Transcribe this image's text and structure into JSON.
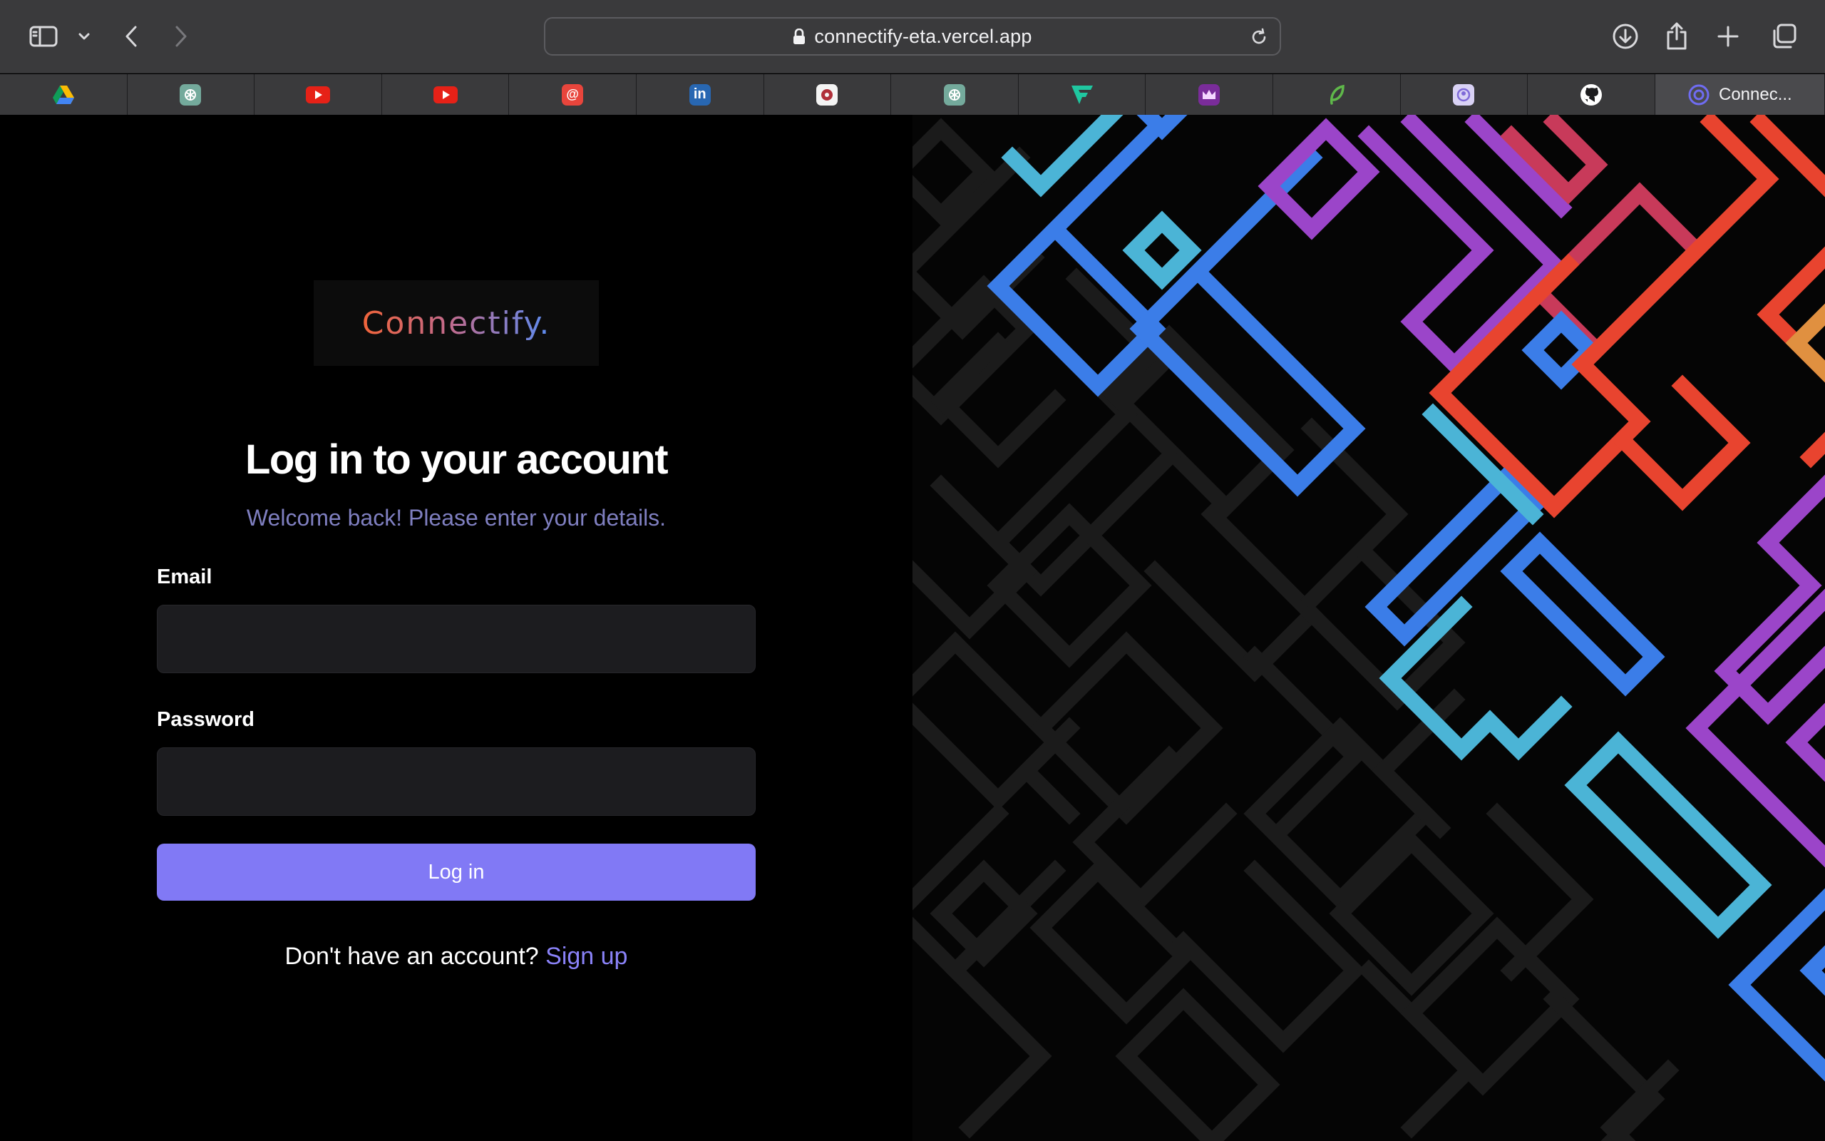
{
  "browser": {
    "url": "connectify-eta.vercel.app",
    "tabs": [
      {
        "icon": "google-drive-icon",
        "color": "#2a7de1"
      },
      {
        "icon": "chatgpt-icon",
        "color": "#74aa9c"
      },
      {
        "icon": "youtube-icon",
        "color": "#e62117"
      },
      {
        "icon": "youtube-icon",
        "color": "#e62117"
      },
      {
        "icon": "mail-at-icon",
        "color": "#e8453c"
      },
      {
        "icon": "linkedin-icon",
        "color": "#2867b2"
      },
      {
        "icon": "gear-badge-icon",
        "color": "#b0303a"
      },
      {
        "icon": "chatgpt-icon",
        "color": "#74aa9c"
      },
      {
        "icon": "vercel-v-icon",
        "color": "#1fc7a0"
      },
      {
        "icon": "crown-icon",
        "color": "#7a2c9a"
      },
      {
        "icon": "leaf-icon",
        "color": "#5fb84a"
      },
      {
        "icon": "app-badge-icon",
        "color": "#7f6ad8"
      },
      {
        "icon": "github-icon",
        "color": "#ffffff"
      }
    ],
    "active_tab": {
      "label": "Connec...",
      "icon": "connectify-icon",
      "color": "#6f6cf2"
    }
  },
  "login": {
    "logo_text": "Connectify.",
    "title": "Log in to your account",
    "subtitle": "Welcome back! Please enter your details.",
    "email_label": "Email",
    "email_value": "",
    "password_label": "Password",
    "password_value": "",
    "submit_label": "Log in",
    "signup_prompt": "Don't have an account?",
    "signup_link": "Sign up"
  },
  "colors": {
    "accent": "#8179f5",
    "subtitle": "#7f7fc0",
    "pattern_blue": "#3b7de8",
    "pattern_cyan": "#4bb4d6",
    "pattern_purple": "#9b45c9",
    "pattern_red": "#e8442f",
    "pattern_crimson": "#c83a5a"
  }
}
